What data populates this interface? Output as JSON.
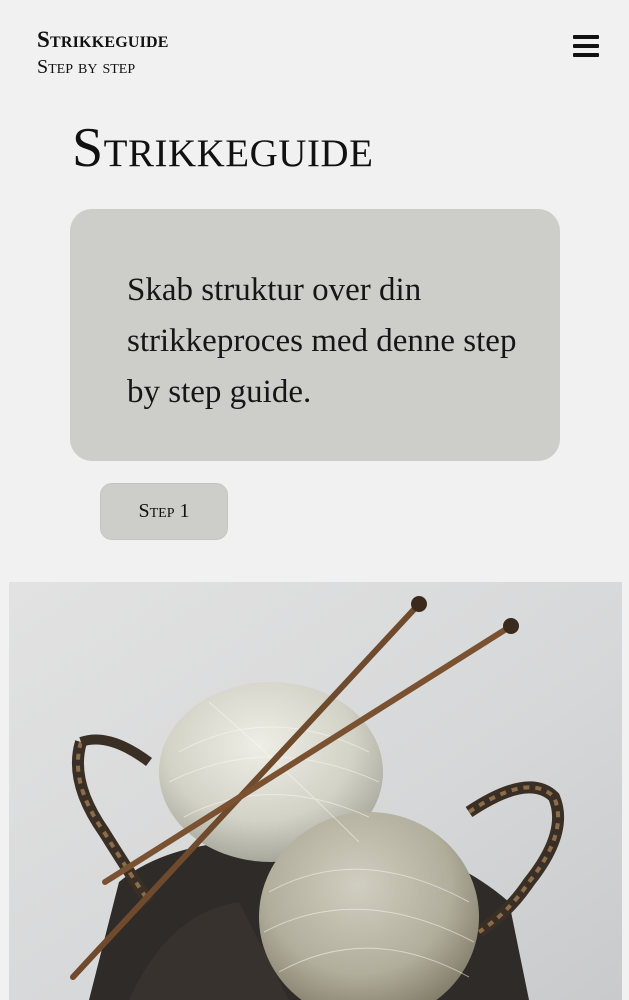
{
  "header": {
    "brand_title": "Strikkeguide",
    "brand_subtitle": "Step by step",
    "menu_icon": "hamburger-menu-icon"
  },
  "main": {
    "title": "Strikkeguide",
    "intro": "Skab struktur over din strikkeproces med denne step by step guide.",
    "step_button_label": "Step 1"
  },
  "hero_image": {
    "subject": "yarn-basket-with-knitting-needles"
  },
  "colors": {
    "background": "#f2f1f1",
    "card": "#cdcdc9",
    "text": "#111111"
  }
}
